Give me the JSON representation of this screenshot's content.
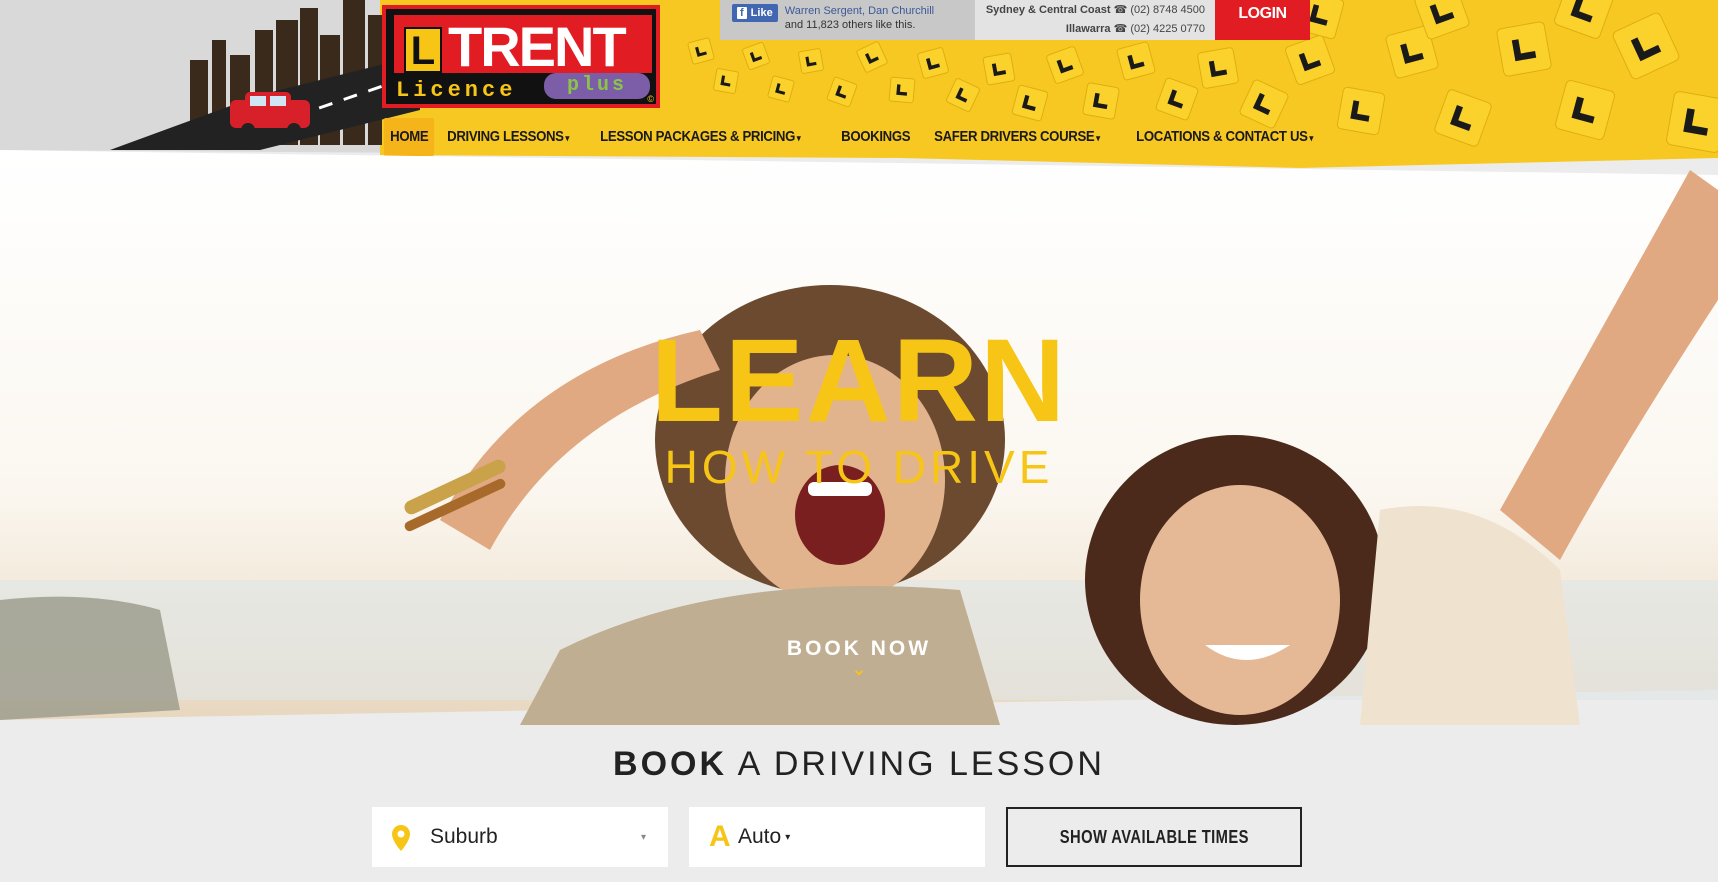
{
  "header": {
    "logo": {
      "letter": "L",
      "word": "TRENT",
      "licence": "Licence",
      "plus": "plus",
      "copyright": "©"
    },
    "facebook": {
      "like_label": "Like",
      "names": "Warren Sergent, Dan Churchill",
      "others": "and 11,823 others like this."
    },
    "contacts": [
      {
        "region": "Sydney & Central Coast",
        "phone": "(02) 8748 4500"
      },
      {
        "region": "Illawarra",
        "phone": "(02) 4225 0770"
      }
    ],
    "login_label": "LOGIN"
  },
  "nav": {
    "items": [
      {
        "label": "HOME",
        "has_dropdown": false,
        "active": true
      },
      {
        "label": "DRIVING LESSONS",
        "has_dropdown": true
      },
      {
        "label": "LESSON PACKAGES & PRICING",
        "has_dropdown": true
      },
      {
        "label": "BOOKINGS",
        "has_dropdown": false
      },
      {
        "label": "SAFER DRIVERS COURSE",
        "has_dropdown": true
      },
      {
        "label": "LOCATIONS & CONTACT US",
        "has_dropdown": true
      }
    ],
    "caret": "▾"
  },
  "hero": {
    "title": "LEARN",
    "subtitle": "HOW TO DRIVE",
    "cta": "BOOK NOW",
    "cta_chevron": "⌄"
  },
  "booking": {
    "title_bold": "BOOK",
    "title_rest": " A DRIVING LESSON",
    "suburb_value": "Suburb",
    "suburb_caret": "▾",
    "transmission_icon": "A",
    "transmission_value": "Auto",
    "transmission_caret": "▾",
    "submit_label": "SHOW AVAILABLE TIMES"
  },
  "colors": {
    "brand_yellow": "#f7c516",
    "brand_red": "#e21c23",
    "nav_active": "#f5b51a"
  }
}
